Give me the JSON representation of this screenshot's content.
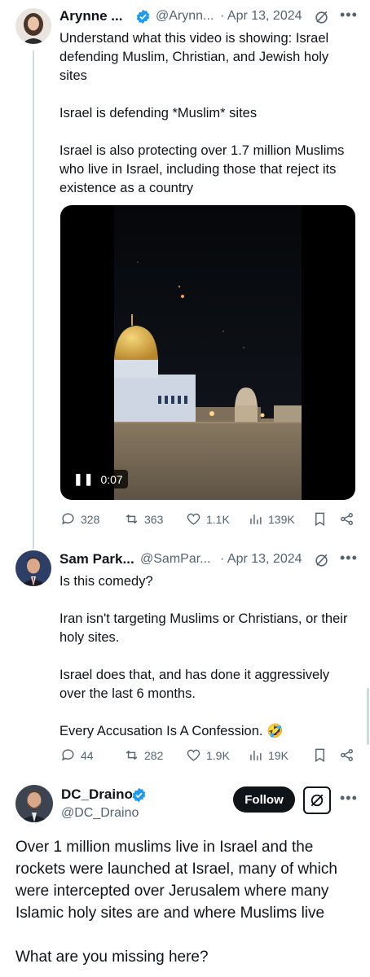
{
  "tweet1": {
    "name": "Arynne ...",
    "handle": "@Arynn...",
    "date": "· Apr 13, 2024",
    "paragraphs": [
      "Understand what this video is showing: Israel defending Muslim, Christian, and Jewish holy sites",
      "Israel is defending *Muslim* sites",
      "Israel is also protecting over 1.7 million Muslims who live in Israel, including those that reject its existence as a country"
    ],
    "video_time": "0:07",
    "actions": {
      "replies": "328",
      "reposts": "363",
      "likes": "1.1K",
      "views": "139K"
    }
  },
  "tweet2": {
    "name": "Sam Park...",
    "handle": "@SamPar...",
    "date": "· Apr 13, 2024",
    "paragraphs": [
      "Is this comedy?",
      "Iran isn't targeting Muslims or Christians, or their holy sites.",
      "Israel does that, and has done it aggressively over the last 6 months.",
      "Every Accusation Is A Confession. 🤣"
    ],
    "actions": {
      "replies": "44",
      "reposts": "282",
      "likes": "1.9K",
      "views": "19K"
    }
  },
  "tweet3": {
    "name": "DC_Draino",
    "handle": "@DC_Draino",
    "follow_label": "Follow",
    "paragraphs": [
      "Over 1 million muslims live in Israel and the rockets were launched at Israel, many of which were intercepted over Jerusalem where many Islamic holy sites are and where Muslims live",
      "What are you missing here?"
    ]
  },
  "colors": {
    "verified": "#1d9bf0",
    "muted": "#536471",
    "text": "#0f1419"
  }
}
